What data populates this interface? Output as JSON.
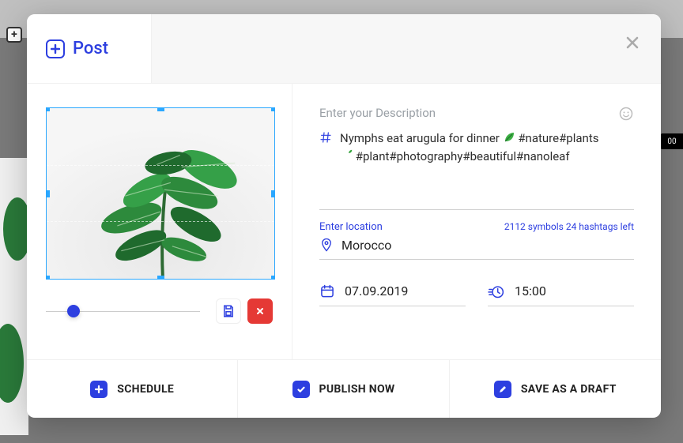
{
  "tab": {
    "label": "Post"
  },
  "background": {
    "badge": "00"
  },
  "description": {
    "placeholder": "Enter your Description",
    "text_line1": "Nymphs eat arugula for dinner ",
    "text_line1_tags": " #nature#plants",
    "text_line2_tags": " #plant#photography#beautiful#nanoleaf",
    "counter": "2112 symbols 24 hashtags left"
  },
  "location": {
    "label": "Enter location",
    "value": "Morocco"
  },
  "datetime": {
    "date": "07.09.2019",
    "time": "15:00"
  },
  "footer": {
    "schedule": "SCHEDULE",
    "publish": "PUBLISH NOW",
    "draft": "SAVE AS A DRAFT"
  }
}
